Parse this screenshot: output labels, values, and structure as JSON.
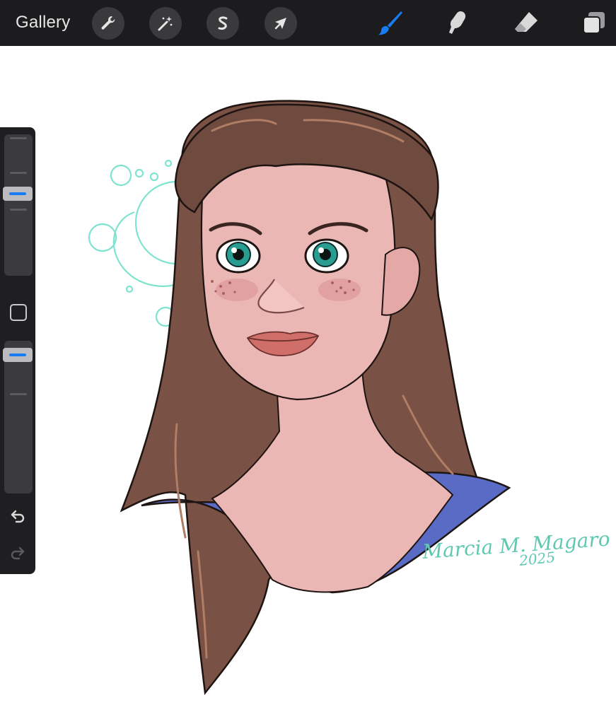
{
  "topbar": {
    "gallery_label": "Gallery",
    "left_tools": [
      {
        "name": "wrench-icon"
      },
      {
        "name": "magic-wand-icon"
      },
      {
        "name": "selection-s-icon"
      },
      {
        "name": "arrow-icon"
      }
    ],
    "right_tools": [
      {
        "name": "brush-icon",
        "active": true
      },
      {
        "name": "smudge-icon"
      },
      {
        "name": "eraser-icon"
      },
      {
        "name": "layers-icon"
      }
    ],
    "accent_color": "#1a7cf4"
  },
  "sidebar": {
    "brush_size": 0.33,
    "opacity": 0.33,
    "undo_icon": "undo-icon",
    "redo_icon": "redo-icon"
  },
  "canvas": {
    "signature_name": "Marcia M. Magaro",
    "signature_year": "2025",
    "signature_color": "#5fc9b0"
  }
}
